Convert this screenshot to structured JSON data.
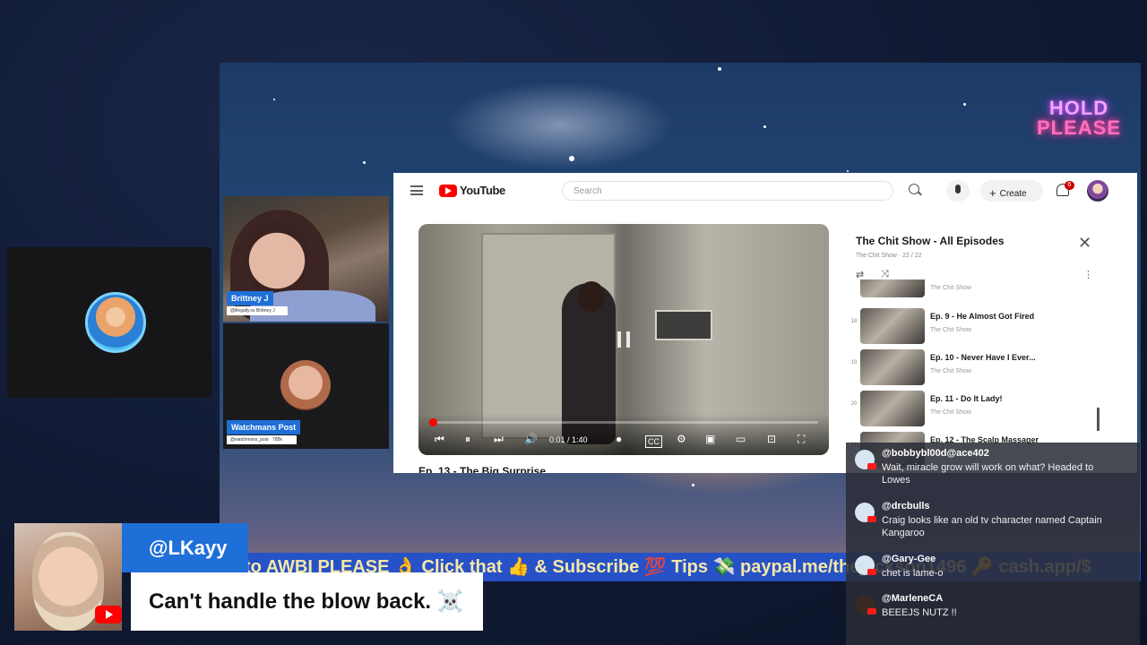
{
  "overlay": {
    "hold_line1": "HOLD",
    "hold_line2": "PLEASE"
  },
  "participants": [
    {
      "name": "Brittney J",
      "handle": "@illegally.vs Brittney J"
    },
    {
      "name": "Watchmans Post",
      "handle": "@watchmans_post · 785k"
    }
  ],
  "youtube": {
    "logo_text": "YouTube",
    "search_placeholder": "Search",
    "create_label": "Create",
    "notification_count": "6",
    "player": {
      "time": "0:01 / 1:40",
      "progress": 0.01
    },
    "video_title": "Ep. 13 - The Big Surprise",
    "playlist": {
      "title": "The Chit Show - All Episodes",
      "subtitle": "The Chit Show · 22 / 22",
      "items": [
        {
          "index": "",
          "title": "",
          "channel": "The Chit Show"
        },
        {
          "index": "18",
          "title": "Ep. 9 - He Almost Got Fired",
          "channel": "The Chit Show"
        },
        {
          "index": "19",
          "title": "Ep. 10 - Never Have I Ever...",
          "channel": "The Chit Show"
        },
        {
          "index": "20",
          "title": "Ep. 11 - Do It Lady!",
          "channel": "The Chit Show"
        },
        {
          "index": "21",
          "title": "Ep. 12 - The Scalp Massager",
          "channel": ""
        }
      ]
    }
  },
  "ticker": {
    "text": "to AWBI PLEASE 👌 Click that 👍 & Subscribe 💯 Tips 💸 paypal.me/thejackson1496 🔑 cash.app/$"
  },
  "chat": [
    {
      "user": "@bobbybl00d@ace402",
      "text": "Wait, miracle grow will work on what? Headed to Lowes",
      "avatar": "light"
    },
    {
      "user": "@drcbulls",
      "text": "Craig looks like an old tv character named Captain Kangaroo",
      "avatar": "light"
    },
    {
      "user": "@Gary-Gee",
      "text": "chet is lame-o",
      "avatar": "light"
    },
    {
      "user": "@MarleneCA",
      "text": "BEEEJS NUTZ !!",
      "avatar": "dark"
    }
  ],
  "featured_comment": {
    "user": "@LKayy",
    "text": "Can't handle the blow back. ☠️"
  },
  "colors": {
    "brand_blue": "#1f6fd8",
    "youtube_red": "#ff0000",
    "neon_pink": "#ff6fbf"
  }
}
